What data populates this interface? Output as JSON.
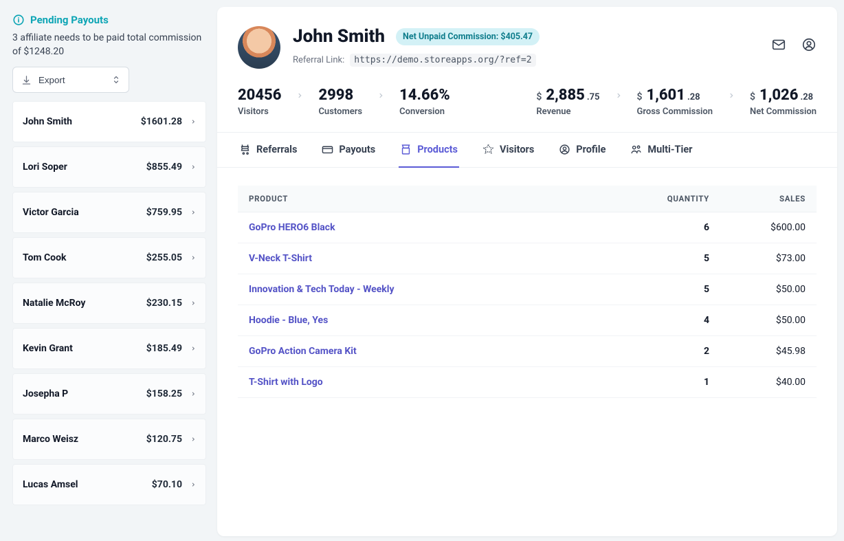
{
  "sidebar": {
    "pending_title": "Pending Payouts",
    "pending_desc": "3 affiliate needs to be paid total commission of $1248.20",
    "export_label": "Export",
    "affiliates": [
      {
        "name": "John Smith",
        "amount": "$1601.28",
        "active": true
      },
      {
        "name": "Lori Soper",
        "amount": "$855.49"
      },
      {
        "name": "Victor Garcia",
        "amount": "$759.95"
      },
      {
        "name": "Tom Cook",
        "amount": "$255.05"
      },
      {
        "name": "Natalie McRoy",
        "amount": "$230.15"
      },
      {
        "name": "Kevin Grant",
        "amount": "$185.49"
      },
      {
        "name": "Josepha P",
        "amount": "$158.25"
      },
      {
        "name": "Marco Weisz",
        "amount": "$120.75"
      },
      {
        "name": "Lucas Amsel",
        "amount": "$70.10"
      }
    ]
  },
  "profile": {
    "name": "John Smith",
    "badge": "Net Unpaid Commission: $405.47",
    "referral_label": "Referral Link:",
    "referral_url": "https://demo.storeapps.org/?ref=2"
  },
  "stats": {
    "visitors": {
      "value": "20456",
      "label": "Visitors"
    },
    "customers": {
      "value": "2998",
      "label": "Customers"
    },
    "conversion": {
      "value": "14.66%",
      "label": "Conversion"
    },
    "revenue": {
      "currency": "$",
      "amount": "2,885",
      "cents": ".75",
      "label": "Revenue"
    },
    "gross_commission": {
      "currency": "$",
      "amount": "1,601",
      "cents": ".28",
      "label": "Gross Commission"
    },
    "net_commission": {
      "currency": "$",
      "amount": "1,026",
      "cents": ".28",
      "label": "Net Commission"
    }
  },
  "tabs": [
    {
      "id": "referrals",
      "label": "Referrals"
    },
    {
      "id": "payouts",
      "label": "Payouts"
    },
    {
      "id": "products",
      "label": "Products",
      "active": true
    },
    {
      "id": "visitors",
      "label": "Visitors"
    },
    {
      "id": "profile",
      "label": "Profile"
    },
    {
      "id": "multitier",
      "label": "Multi-Tier"
    }
  ],
  "table": {
    "headers": {
      "product": "PRODUCT",
      "quantity": "QUANTITY",
      "sales": "SALES"
    },
    "rows": [
      {
        "product": "GoPro HERO6 Black",
        "quantity": "6",
        "sales": "$600.00"
      },
      {
        "product": "V-Neck T-Shirt",
        "quantity": "5",
        "sales": "$73.00"
      },
      {
        "product": "Innovation & Tech Today - Weekly",
        "quantity": "5",
        "sales": "$50.00"
      },
      {
        "product": "Hoodie - Blue, Yes",
        "quantity": "4",
        "sales": "$50.00"
      },
      {
        "product": "GoPro Action Camera Kit",
        "quantity": "2",
        "sales": "$45.98"
      },
      {
        "product": "T-Shirt with Logo",
        "quantity": "1",
        "sales": "$40.00"
      }
    ]
  }
}
